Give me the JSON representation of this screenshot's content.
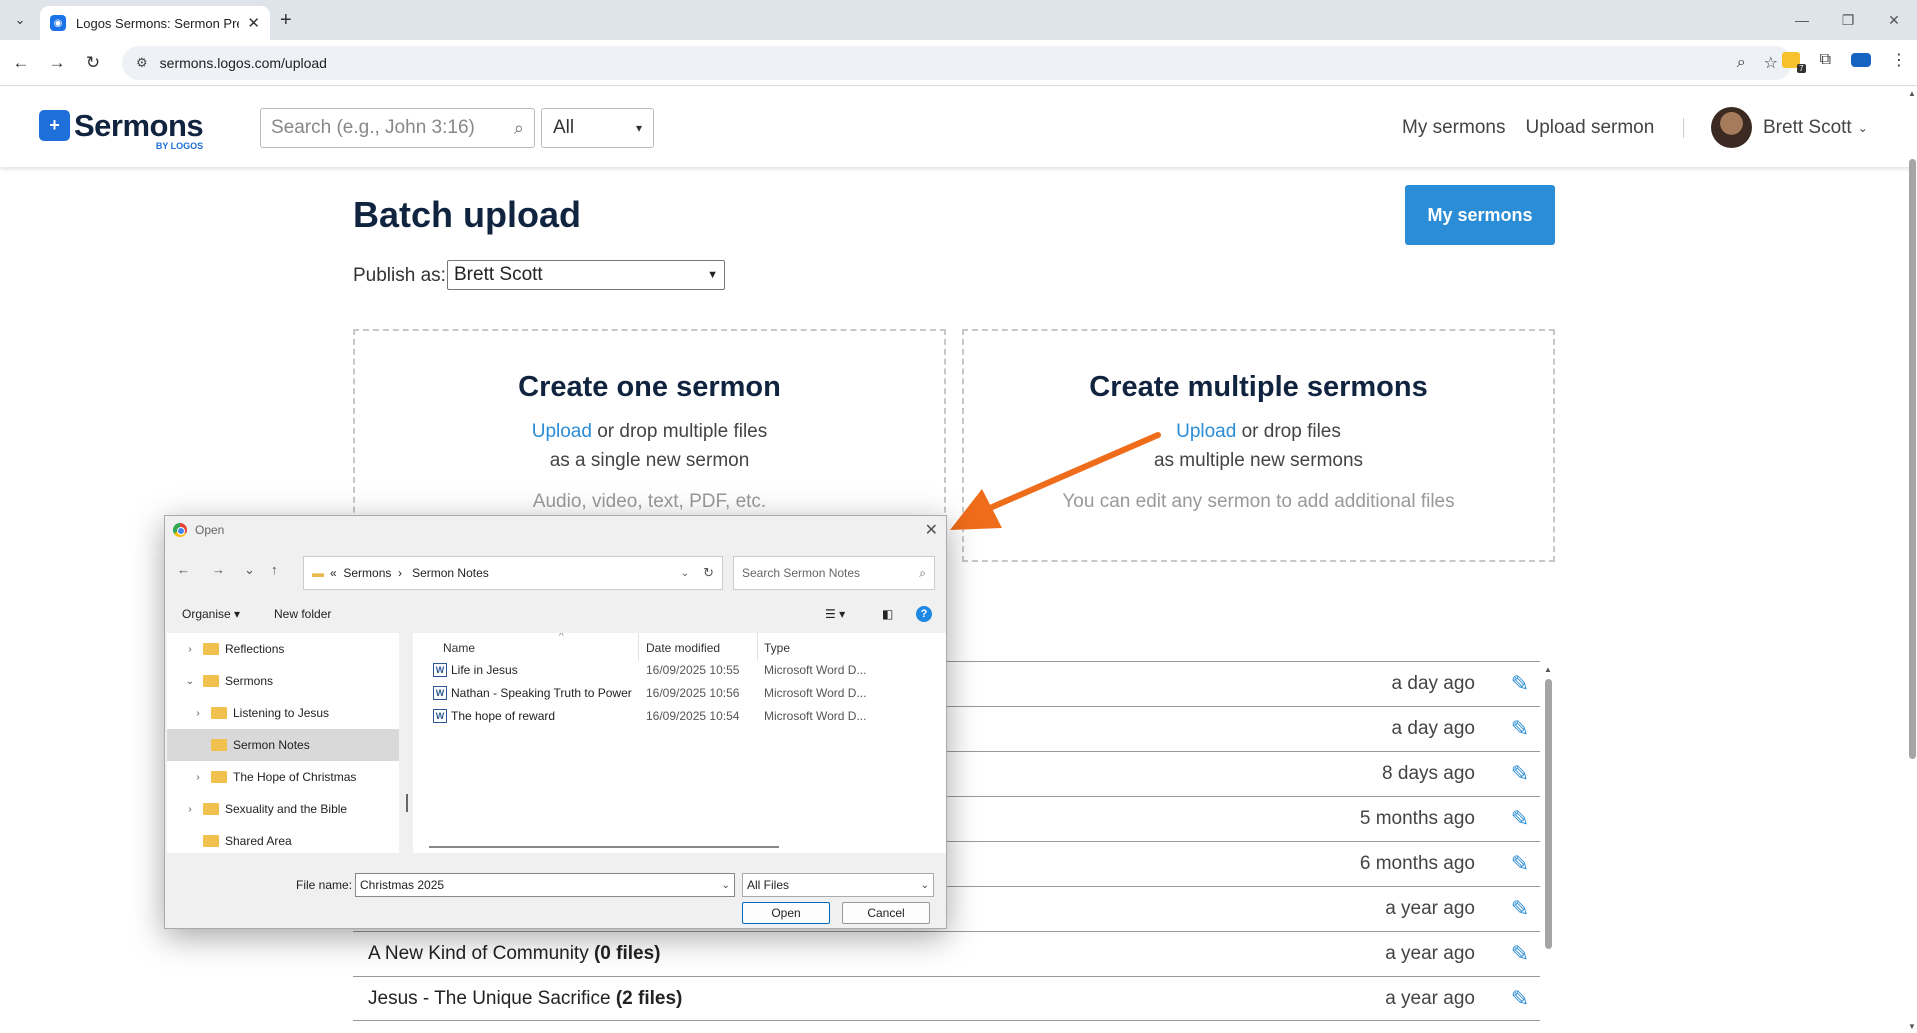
{
  "browser": {
    "tab_title": "Logos Sermons: Sermon Prepar",
    "tab_close": "✕",
    "new_tab": "+",
    "url": "sermons.logos.com/upload",
    "window_controls": {
      "minimize": "—",
      "restore": "❐",
      "close": "✕"
    }
  },
  "site": {
    "logo_word": "Sermons",
    "logo_by": "BY LOGOS",
    "search_placeholder": "Search (e.g., John 3:16)",
    "filter_value": "All",
    "nav": {
      "my_sermons": "My sermons",
      "upload_sermon": "Upload sermon"
    },
    "user_name": "Brett Scott"
  },
  "page": {
    "title": "Batch upload",
    "my_sermons_button": "My sermons",
    "publish_label": "Publish as:",
    "publish_value": "Brett Scott",
    "one": {
      "heading": "Create one sermon",
      "upload_link": "Upload",
      "line1_rest": " or drop multiple files",
      "line2": "as a single new sermon",
      "note": "Audio, video, text, PDF, etc."
    },
    "multi": {
      "heading": "Create multiple sermons",
      "upload_link": "Upload",
      "line1_rest": " or drop files",
      "line2": "as multiple new sermons",
      "note": "You can edit any sermon to add additional files"
    },
    "sermons": [
      {
        "name": "",
        "files": "",
        "age": "a day ago"
      },
      {
        "name": "",
        "files": "",
        "age": "a day ago"
      },
      {
        "name": "",
        "files": "",
        "age": "8 days ago"
      },
      {
        "name": "",
        "files": "",
        "age": "5 months ago"
      },
      {
        "name": "",
        "files": "",
        "age": "6 months ago"
      },
      {
        "name": "",
        "files": "",
        "age": "a year ago"
      },
      {
        "name": "A New Kind of Community ",
        "files": "(0 files)",
        "age": "a year ago"
      },
      {
        "name": "Jesus - The Unique Sacrifice ",
        "files": "(2 files)",
        "age": "a year ago"
      }
    ]
  },
  "dialog": {
    "title": "Open",
    "path_prefix": "«",
    "path": [
      "Sermons",
      "Sermon Notes"
    ],
    "search_placeholder": "Search Sermon Notes",
    "toolbar": {
      "organise": "Organise ▾",
      "new_folder": "New folder"
    },
    "tree": [
      {
        "label": "Reflections",
        "expander": "›",
        "indent": 1,
        "selected": false
      },
      {
        "label": "Sermons",
        "expander": "⌄",
        "indent": 1,
        "selected": false
      },
      {
        "label": "Listening to Jesus",
        "expander": "›",
        "indent": 2,
        "selected": false
      },
      {
        "label": "Sermon Notes",
        "expander": "",
        "indent": 2,
        "selected": true
      },
      {
        "label": "The Hope of Christmas",
        "expander": "›",
        "indent": 2,
        "selected": false
      },
      {
        "label": "Sexuality and the Bible",
        "expander": "›",
        "indent": 1,
        "selected": false
      },
      {
        "label": "Shared Area",
        "expander": "",
        "indent": 1,
        "selected": false
      }
    ],
    "columns": {
      "name": "Name",
      "date": "Date modified",
      "type": "Type"
    },
    "files": [
      {
        "name": "Life in Jesus",
        "date": "16/09/2025 10:55",
        "type": "Microsoft Word D..."
      },
      {
        "name": "Nathan - Speaking Truth to Power",
        "date": "16/09/2025 10:56",
        "type": "Microsoft Word D..."
      },
      {
        "name": "The hope of reward",
        "date": "16/09/2025 10:54",
        "type": "Microsoft Word D..."
      }
    ],
    "file_name_label": "File name:",
    "file_name_value": "Christmas 2025",
    "file_type_value": "All Files",
    "open_button": "Open",
    "cancel_button": "Cancel"
  },
  "colors": {
    "brand_navy": "#10233f",
    "accent_blue": "#2b8dd6",
    "arrow_orange": "#ef6c1a"
  }
}
